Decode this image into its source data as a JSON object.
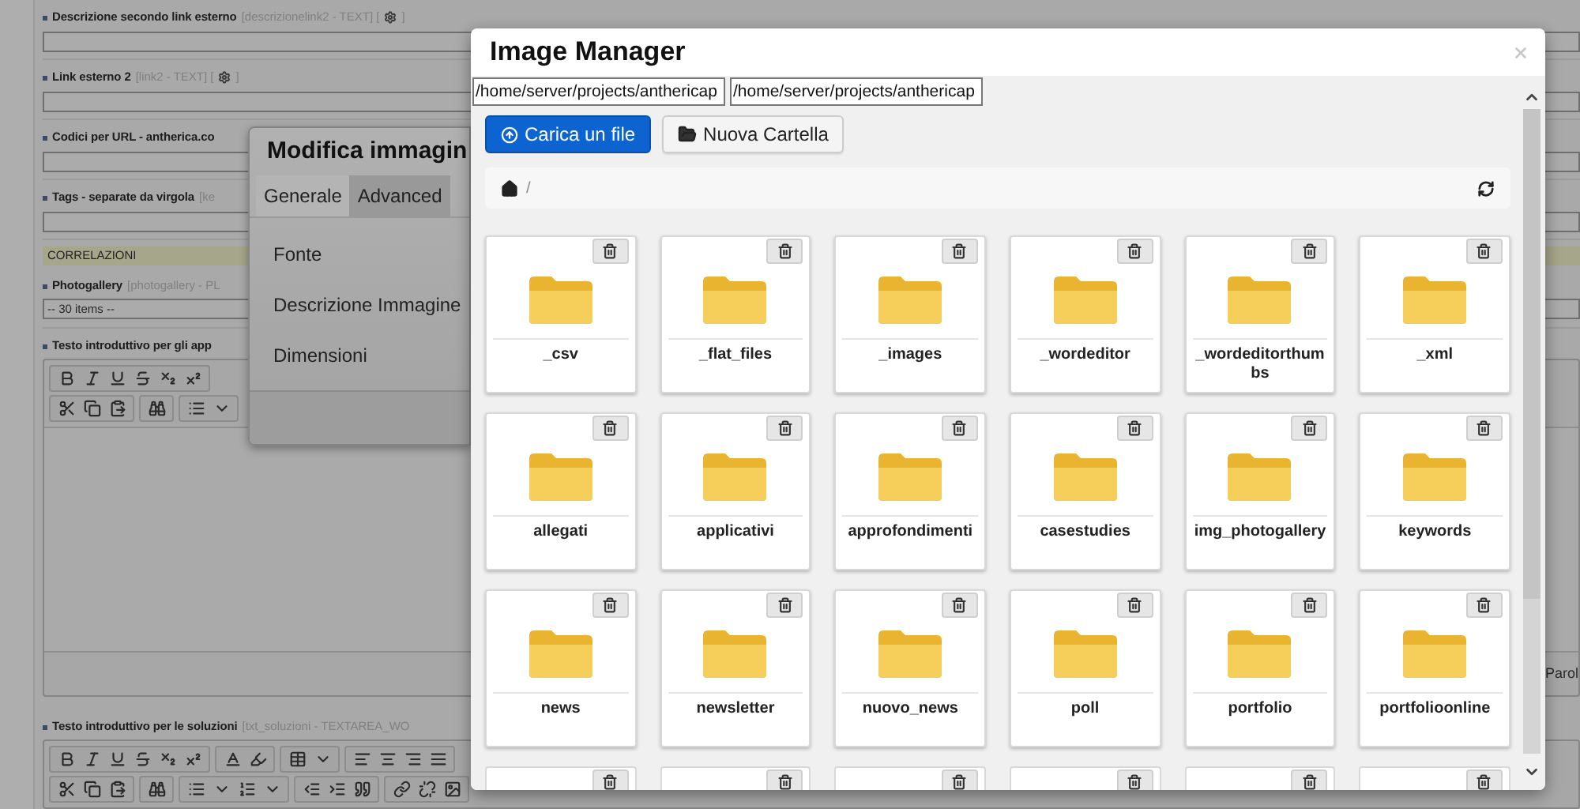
{
  "background_form": {
    "fields": [
      {
        "kind": "text",
        "label": "Descrizione secondo link esterno",
        "hint": "[descrizionelink2 - TEXT] [",
        "hint_end": "]"
      },
      {
        "kind": "text",
        "label": "Link esterno 2",
        "hint": "[link2 - TEXT] [",
        "hint_end": "]"
      },
      {
        "kind": "text",
        "label": "Codici per URL - antherica.co"
      },
      {
        "kind": "text",
        "label": "Tags - separate da virgola",
        "hint": "[ke"
      },
      {
        "kind": "section",
        "label": "CORRELAZIONI"
      },
      {
        "kind": "select",
        "label": "Photogallery",
        "hint": "[photogallery - PL",
        "value": "-- 30 items --"
      },
      {
        "kind": "editor",
        "label": "Testo introduttivo per gli app",
        "footer": "Parol"
      },
      {
        "kind": "editor_top",
        "label": "Testo introduttivo per le soluzioni",
        "hint": "[txt_soluzioni - TEXTAREA_WO"
      }
    ]
  },
  "image_dialog": {
    "title": "Modifica immagin",
    "tabs": [
      {
        "label": "Generale",
        "selected": true
      },
      {
        "label": "Advanced",
        "selected": false
      }
    ],
    "fields": [
      {
        "label": "Fonte"
      },
      {
        "label": "Descrizione Immagine"
      },
      {
        "label": "Dimensioni"
      }
    ]
  },
  "image_manager": {
    "title": "Image Manager",
    "paths": [
      {
        "value": "/home/server/projects/anthericap"
      },
      {
        "value": "/home/server/projects/anthericap"
      }
    ],
    "buttons": [
      {
        "kind": "primary",
        "label": "Carica un file"
      },
      {
        "kind": "default",
        "label": "Nuova Cartella"
      }
    ],
    "breadcrumb": {
      "separator": "/"
    },
    "folders": [
      {
        "kind": "folder",
        "name": "_csv"
      },
      {
        "kind": "folder",
        "name": "_flat_files"
      },
      {
        "kind": "folder",
        "name": "_images"
      },
      {
        "kind": "folder",
        "name": "_wordeditor"
      },
      {
        "kind": "folder",
        "name": "_wordeditorthumbs"
      },
      {
        "kind": "folder",
        "name": "_xml"
      },
      {
        "kind": "folder",
        "name": "allegati"
      },
      {
        "kind": "folder",
        "name": "applicativi"
      },
      {
        "kind": "folder",
        "name": "approfondimenti"
      },
      {
        "kind": "folder",
        "name": "casestudies"
      },
      {
        "kind": "folder",
        "name": "img_photogallery"
      },
      {
        "kind": "folder",
        "name": "keywords"
      },
      {
        "kind": "folder",
        "name": "news"
      },
      {
        "kind": "folder",
        "name": "newsletter"
      },
      {
        "kind": "folder",
        "name": "nuovo_news"
      },
      {
        "kind": "folder",
        "name": "poll"
      },
      {
        "kind": "folder",
        "name": "portfolio"
      },
      {
        "kind": "folder",
        "name": "portfolioonline"
      },
      {
        "kind": "cut"
      },
      {
        "kind": "cut"
      },
      {
        "kind": "cut"
      },
      {
        "kind": "cut"
      },
      {
        "kind": "cut"
      },
      {
        "kind": "cut"
      }
    ]
  }
}
